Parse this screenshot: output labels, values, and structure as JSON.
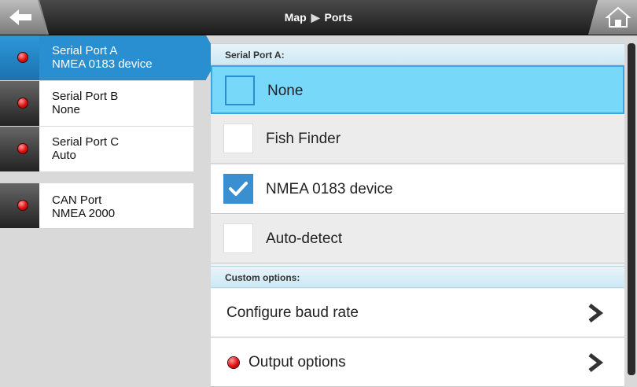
{
  "header": {
    "breadcrumb_root": "Map",
    "breadcrumb_current": "Ports"
  },
  "sidebar": {
    "ports": [
      {
        "name": "Serial Port A",
        "value": "NMEA 0183 device",
        "active": true
      },
      {
        "name": "Serial Port B",
        "value": "None"
      },
      {
        "name": "Serial Port C",
        "value": "Auto"
      },
      {
        "name": "CAN Port",
        "value": "NMEA 2000"
      }
    ]
  },
  "panel": {
    "section_title": "Serial Port A:",
    "options": [
      {
        "label": "None",
        "selected": true,
        "checked": false
      },
      {
        "label": "Fish Finder",
        "selected": false,
        "checked": false
      },
      {
        "label": "NMEA 0183 device",
        "selected": false,
        "checked": true
      },
      {
        "label": "Auto-detect",
        "selected": false,
        "checked": false
      }
    ],
    "custom_title": "Custom options:",
    "custom": [
      {
        "label": "Configure baud rate"
      },
      {
        "label": "Output options"
      }
    ]
  },
  "colors": {
    "accent": "#2a8fd0",
    "selected_bg": "#78d8fa",
    "led": "#e01010"
  }
}
